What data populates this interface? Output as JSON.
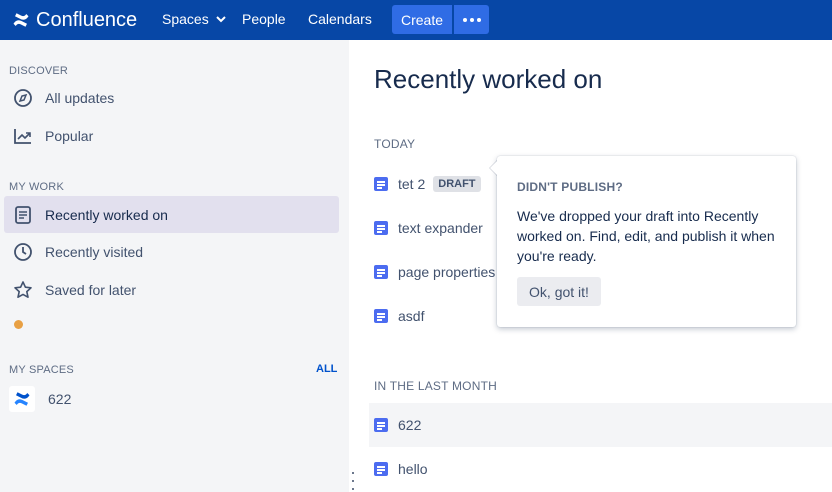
{
  "topnav": {
    "logo_text": "Confluence",
    "spaces_label": "Spaces",
    "people_label": "People",
    "calendars_label": "Calendars",
    "create_label": "Create",
    "bg_color": "#0747a6"
  },
  "sidebar": {
    "discover_heading": "DISCOVER",
    "discover_items": [
      {
        "label": "All updates",
        "icon": "compass-icon"
      },
      {
        "label": "Popular",
        "icon": "trending-icon"
      }
    ],
    "mywork_heading": "MY WORK",
    "mywork_items": [
      {
        "label": "Recently worked on",
        "icon": "document-icon",
        "active": true
      },
      {
        "label": "Recently visited",
        "icon": "clock-icon"
      },
      {
        "label": "Saved for later",
        "icon": "star-icon"
      }
    ],
    "myspaces_heading": "MY SPACES",
    "all_link": "ALL",
    "spaces": [
      {
        "label": "622",
        "icon": "confluence-space-icon"
      }
    ]
  },
  "main": {
    "title": "Recently worked on",
    "today_label": "TODAY",
    "today_pages": [
      {
        "title": "tet 2",
        "badge": "DRAFT"
      },
      {
        "title": "text expander"
      },
      {
        "title": "page properties"
      },
      {
        "title": "asdf"
      }
    ],
    "last_month_label": "IN THE LAST MONTH",
    "last_month_pages": [
      {
        "title": "622"
      },
      {
        "title": "hello"
      }
    ]
  },
  "popover": {
    "title": "DIDN'T PUBLISH?",
    "body": "We've dropped your draft into Recently worked on. Find, edit, and publish it when you're ready.",
    "button": "Ok, got it!"
  }
}
